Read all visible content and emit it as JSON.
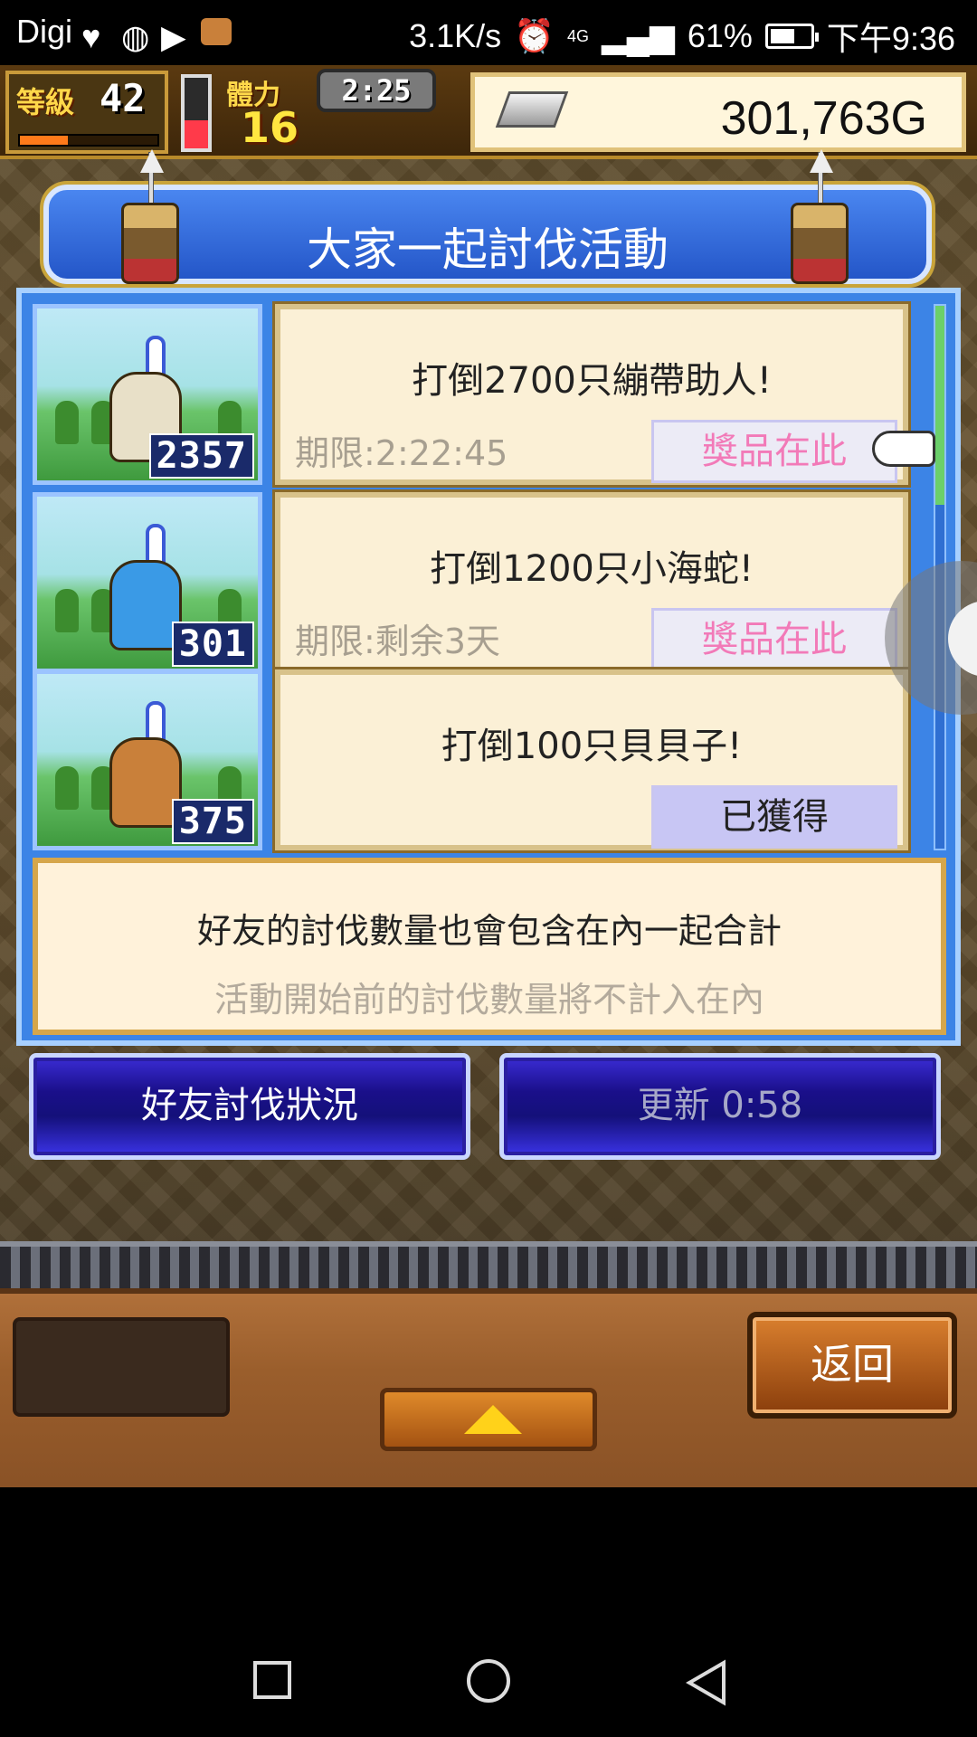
{
  "status_bar": {
    "carrier": "Digi",
    "speed": "3.1K/s",
    "network": "4G",
    "battery": "61%",
    "battery_level": 0.61,
    "time": "下午9:36"
  },
  "hud": {
    "level_label": "等級",
    "level": "42",
    "level_progress": 0.35,
    "stamina_label": "體力",
    "stamina": "16",
    "stamina_level": 0.4,
    "timer": "2:25",
    "gold": "301,763G"
  },
  "dialog": {
    "title": "大家一起討伐活動",
    "missions": [
      {
        "target": "打倒2700只繃帶助人!",
        "deadline": "期限:2:22:45",
        "prize": "獎品在此",
        "count": "2357",
        "obtained": false,
        "monster_color": "#e8e0c8"
      },
      {
        "target": "打倒1200只小海蛇!",
        "deadline": "期限:剩余3天",
        "prize": "獎品在此",
        "count": "301",
        "obtained": false,
        "monster_color": "#3a9ae6"
      },
      {
        "target": "打倒100只貝貝子!",
        "deadline": "",
        "prize": "已獲得",
        "count": "375",
        "obtained": true,
        "monster_color": "#c9803a"
      }
    ],
    "info_line1": "好友的討伐數量也會包含在內一起合計",
    "info_line2": "活動開始前的討伐數量將不計入在內"
  },
  "buttons": {
    "friends_status": "好友討伐狀況",
    "refresh": "更新 0:58",
    "back": "返回"
  },
  "colors": {
    "dialog_blue": "#3c84e6",
    "prize_pink": "#f27ab8",
    "gold_text": "#ffd84a"
  }
}
